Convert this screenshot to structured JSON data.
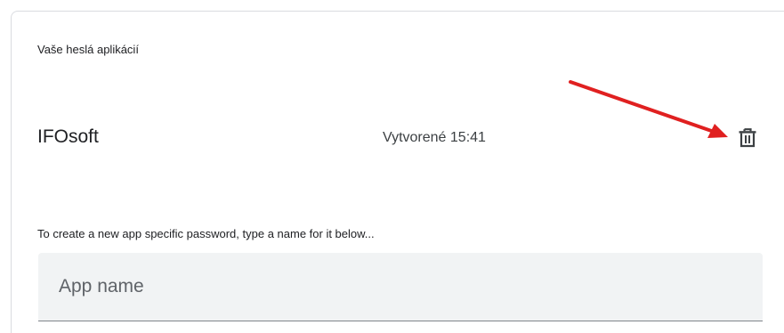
{
  "section": {
    "title": "Vaše heslá aplikácií"
  },
  "passwords": [
    {
      "name": "IFOsoft",
      "created": "Vytvorené 15:41",
      "delete_icon": "trash-icon"
    }
  ],
  "new_password": {
    "help_text": "To create a new app specific password, type a name for it below...",
    "placeholder": "App name",
    "value": ""
  },
  "annotation": {
    "arrow_color": "#e02020"
  }
}
